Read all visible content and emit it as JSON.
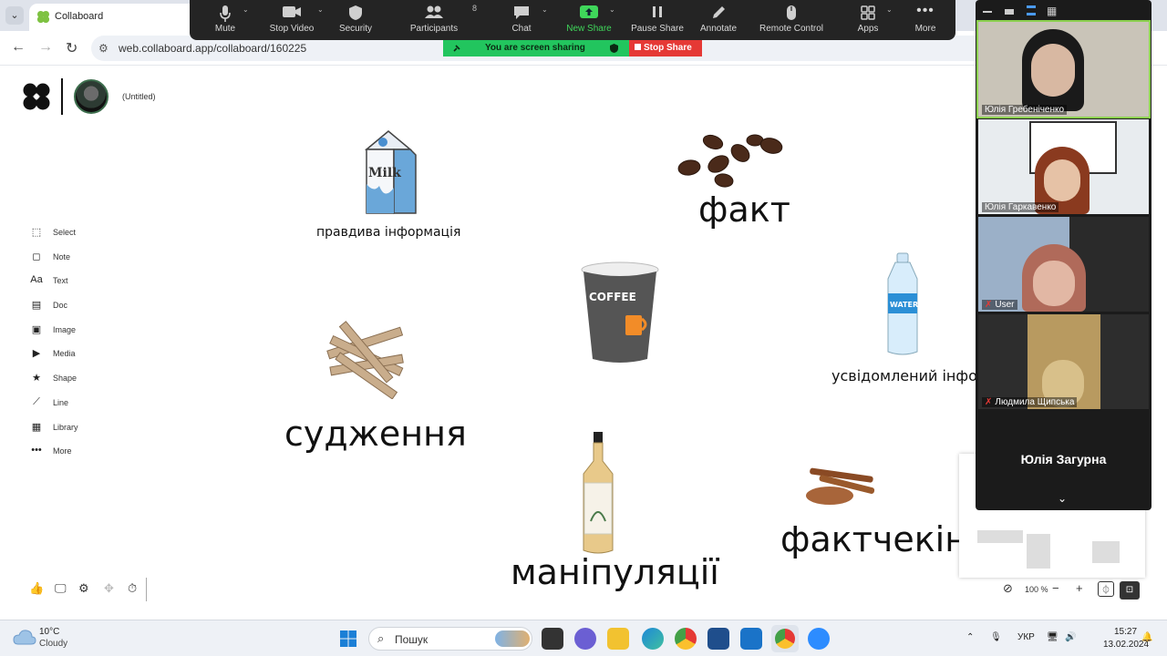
{
  "browser": {
    "tab_title": "Collaboard",
    "url": "web.collaboard.app/collaboard/160225"
  },
  "zoom_toolbar": {
    "items": [
      {
        "label": "Mute",
        "icon": "microphone-icon"
      },
      {
        "label": "Stop Video",
        "icon": "video-camera-icon"
      },
      {
        "label": "Security",
        "icon": "shield-icon"
      },
      {
        "label": "Participants",
        "icon": "participants-icon",
        "count": "8"
      },
      {
        "label": "Chat",
        "icon": "chat-icon"
      },
      {
        "label": "New Share",
        "icon": "share-up-arrow-icon"
      },
      {
        "label": "Pause Share",
        "icon": "pause-icon"
      },
      {
        "label": "Annotate",
        "icon": "pencil-icon"
      },
      {
        "label": "Remote Control",
        "icon": "mouse-icon"
      },
      {
        "label": "Apps",
        "icon": "apps-icon"
      },
      {
        "label": "More",
        "icon": "more-dots-icon"
      }
    ],
    "sharing_banner": "You are screen sharing",
    "stop_share": "Stop Share"
  },
  "collaboard": {
    "board_title": "(Untitled)",
    "tools": [
      {
        "label": "Select",
        "icon": "select-icon"
      },
      {
        "label": "Note",
        "icon": "note-icon"
      },
      {
        "label": "Text",
        "icon": "text-icon",
        "glyph": "Aa"
      },
      {
        "label": "Doc",
        "icon": "document-icon"
      },
      {
        "label": "Image",
        "icon": "image-icon"
      },
      {
        "label": "Media",
        "icon": "media-icon"
      },
      {
        "label": "Shape",
        "icon": "star-icon"
      },
      {
        "label": "Line",
        "icon": "line-icon"
      },
      {
        "label": "Library",
        "icon": "library-icon"
      },
      {
        "label": "More",
        "icon": "more-icon"
      }
    ],
    "zoom_level": "100 %",
    "canvas_labels": {
      "milk": "правдива інформація",
      "beans": "факт",
      "water": "усвідомлений інфопр",
      "sticks": "судження",
      "syrup": "маніпуляції",
      "cinnamon": "фактчекін"
    },
    "canvas_images": {
      "milk_text": "Milk",
      "coffee_text": "COFFEE",
      "water_text": "WATER"
    }
  },
  "participants": [
    {
      "name": "Юлія Гребеніченко"
    },
    {
      "name": "Юлія Гаркавенко"
    },
    {
      "name": "User"
    },
    {
      "name": "Людмила Щипська"
    },
    {
      "name": "Юлія Загурна"
    }
  ],
  "taskbar": {
    "weather_temp": "10°C",
    "weather_desc": "Cloudy",
    "search_placeholder": "Пошук",
    "language": "УКР",
    "time": "15:27",
    "date": "13.02.2024"
  },
  "colors": {
    "zoom_bar": "#242424",
    "share_green": "#22c55e",
    "stop_red": "#e53935",
    "active_speaker": "#8bd04f"
  }
}
